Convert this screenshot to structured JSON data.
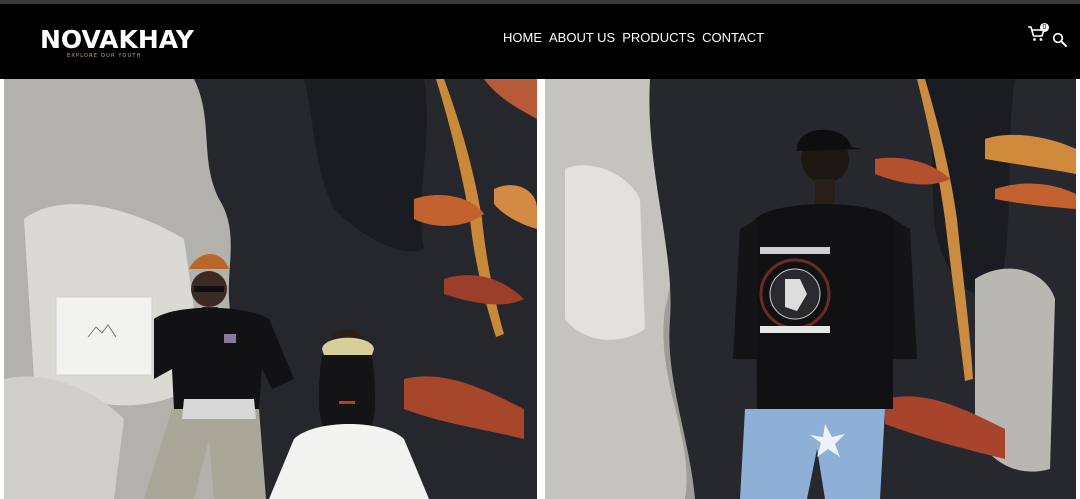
{
  "brand": {
    "name": "NOVAKHAY",
    "tagline": "EXPLORE OUR YOUTH"
  },
  "nav": {
    "items": [
      {
        "label": "HOME"
      },
      {
        "label": "ABOUT US"
      },
      {
        "label": "PRODUCTS"
      },
      {
        "label": "CONTACT"
      }
    ]
  },
  "cart": {
    "icon": "cart-icon",
    "count": "0"
  },
  "search": {
    "icon": "search-icon"
  },
  "colors": {
    "header_bg": "#000000",
    "text": "#ffffff",
    "tagline": "#bfae7a"
  }
}
